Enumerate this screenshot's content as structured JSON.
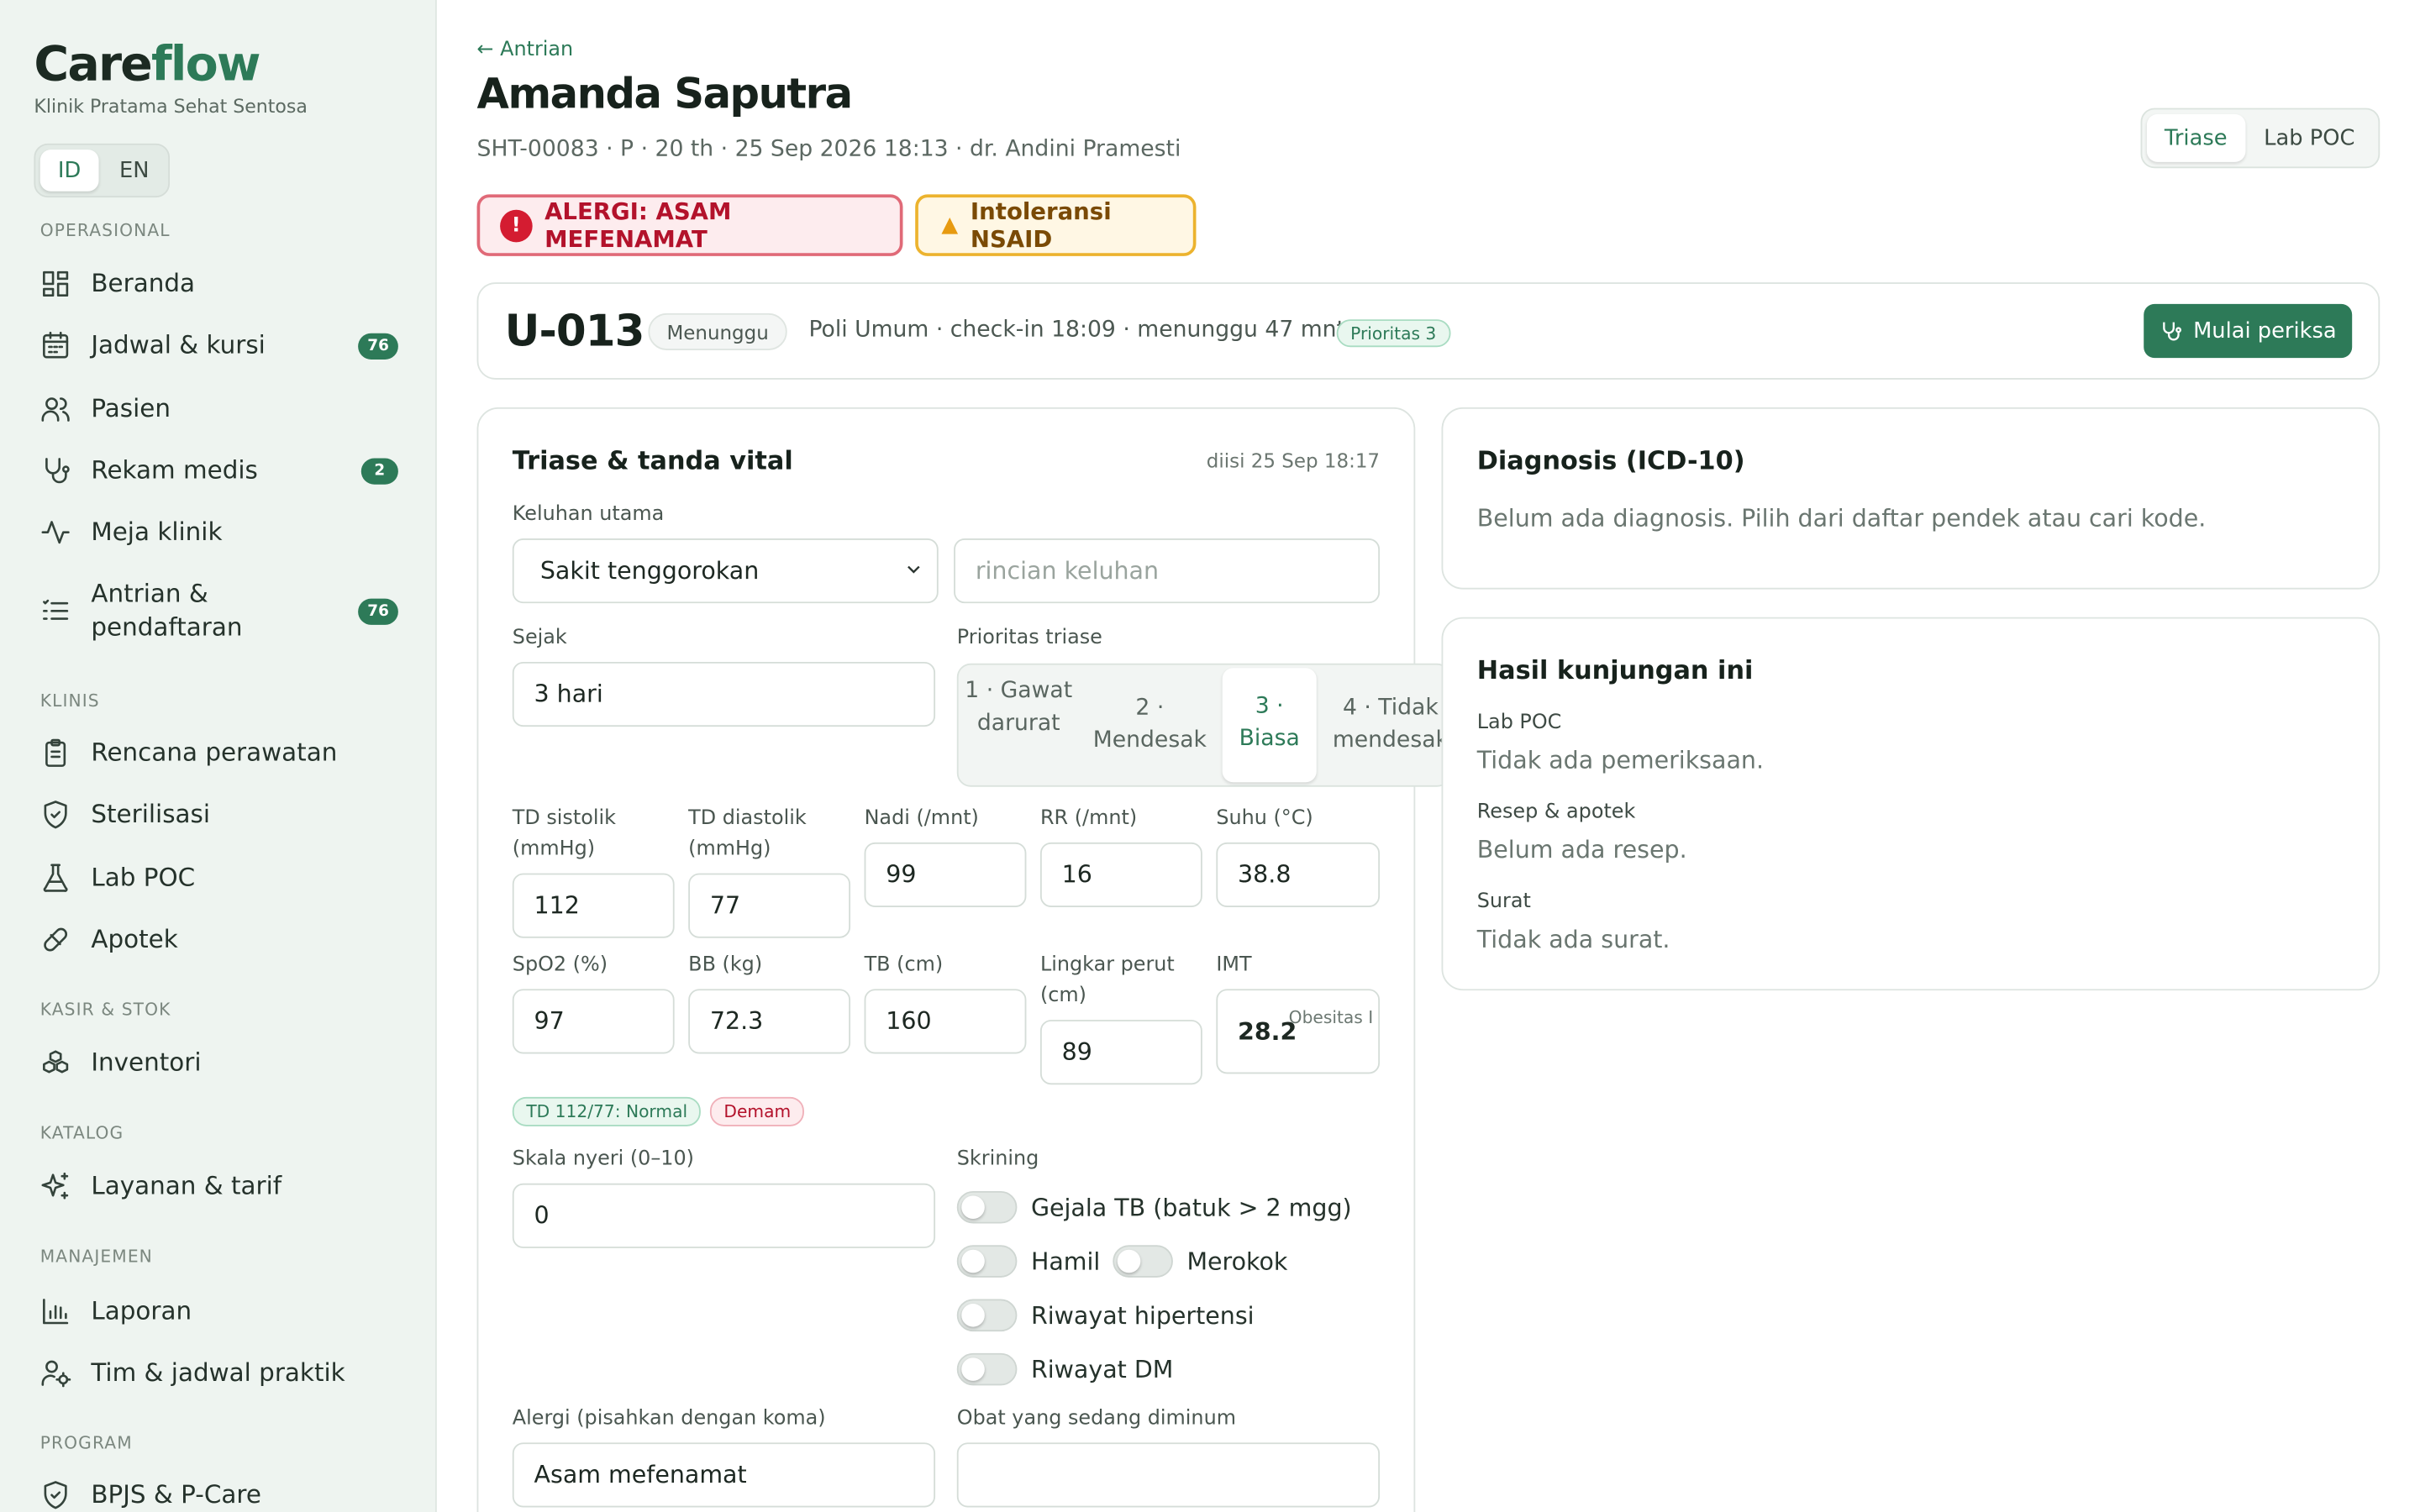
{
  "brand": {
    "part1": "Care",
    "part2": "flow",
    "clinic": "Klinik Pratama Sehat Sentosa"
  },
  "lang": {
    "id": "ID",
    "en": "EN",
    "active": "ID"
  },
  "sidebar": {
    "sections": [
      "OPERASIONAL",
      "KLINIS",
      "KASIR & STOK",
      "KATALOG",
      "MANAJEMEN",
      "PROGRAM"
    ],
    "items": [
      {
        "label": "Beranda",
        "icon": "dashboard-icon"
      },
      {
        "label": "Jadwal & kursi",
        "icon": "calendar-icon",
        "badge": "76"
      },
      {
        "label": "Pasien",
        "icon": "users-icon"
      },
      {
        "label": "Rekam medis",
        "icon": "stethoscope-icon",
        "badge": "2"
      },
      {
        "label": "Meja klinik",
        "icon": "activity-icon"
      },
      {
        "label": "Antrian & pendaftaran",
        "icon": "list-icon",
        "badge": "76"
      },
      {
        "label": "Rencana perawatan",
        "icon": "clipboard-icon"
      },
      {
        "label": "Sterilisasi",
        "icon": "shield-icon"
      },
      {
        "label": "Lab POC",
        "icon": "flask-icon"
      },
      {
        "label": "Apotek",
        "icon": "pill-icon"
      },
      {
        "label": "Inventori",
        "icon": "boxes-icon"
      },
      {
        "label": "Layanan & tarif",
        "icon": "sparkles-icon"
      },
      {
        "label": "Laporan",
        "icon": "bar-chart-icon"
      },
      {
        "label": "Tim & jadwal praktik",
        "icon": "user-cog-icon"
      },
      {
        "label": "BPJS & P-Care",
        "icon": "shield-check-icon"
      }
    ]
  },
  "header": {
    "back": "← Antrian",
    "patient_name": "Amanda Saputra",
    "meta": "SHT-00083 · P · 20 th · 25 Sep 2026 18:13 · dr. Andini Pramesti",
    "tabs": [
      "Triase",
      "Lab POC"
    ],
    "active_tab": "Triase"
  },
  "alerts": {
    "allergy": "ALERGI: ASAM MEFENAMAT",
    "intolerance": "Intoleransi NSAID"
  },
  "queue": {
    "number": "U-013",
    "status": "Menunggu",
    "info": "Poli Umum · check-in 18:09 · menunggu 47 mnt ·",
    "priority": "Prioritas 3",
    "start_button": "Mulai periksa"
  },
  "triage": {
    "title": "Triase & tanda vital",
    "filled": "diisi 25 Sep 18:17",
    "complaint_label": "Keluhan utama",
    "complaint_value": "Sakit tenggorokan",
    "complaint_detail_placeholder": "rincian keluhan",
    "since_label": "Sejak",
    "since_value": "3 hari",
    "priority_label": "Prioritas triase",
    "priority_options": [
      "1 · Gawat darurat",
      "2 · Mendesak",
      "3 · Biasa",
      "4 · Tidak mendesak"
    ],
    "priority_selected": "3 · Biasa",
    "vitals": {
      "sys_label": "TD sistolik (mmHg)",
      "sys": "112",
      "dia_label": "TD diastolik (mmHg)",
      "dia": "77",
      "pulse_label": "Nadi (/mnt)",
      "pulse": "99",
      "rr_label": "RR (/mnt)",
      "rr": "16",
      "temp_label": "Suhu (°C)",
      "temp": "38.8",
      "spo2_label": "SpO2 (%)",
      "spo2": "97",
      "bb_label": "BB (kg)",
      "bb": "72.3",
      "tb_label": "TB (cm)",
      "tb": "160",
      "waist_label": "Lingkar perut (cm)",
      "waist": "89",
      "imt_label": "IMT",
      "imt": "28.2",
      "imt_class": "Obesitas I"
    },
    "tags": {
      "bp": "TD 112/77: Normal",
      "fever": "Demam"
    },
    "pain_label": "Skala nyeri (0–10)",
    "pain_value": "0",
    "screening_label": "Skrining",
    "screening": [
      "Gejala TB (batuk > 2 mgg)",
      "Hamil",
      "Merokok",
      "Riwayat hipertensi",
      "Riwayat DM"
    ],
    "allergy_label": "Alergi (pisahkan dengan koma)",
    "allergy_value": "Asam mefenamat",
    "meds_label": "Obat yang sedang diminum",
    "meds_value": ""
  },
  "diagnosis": {
    "title": "Diagnosis (ICD-10)",
    "empty": "Belum ada diagnosis. Pilih dari daftar pendek atau cari kode."
  },
  "visit": {
    "title": "Hasil kunjungan ini",
    "lab_label": "Lab POC",
    "lab_value": "Tidak ada pemeriksaan.",
    "rx_label": "Resep & apotek",
    "rx_value": "Belum ada resep.",
    "letter_label": "Surat",
    "letter_value": "Tidak ada surat."
  },
  "colors": {
    "accent": "#2d7a58",
    "danger": "#d41c31",
    "warning": "#ecb32e",
    "sidebar": "#eef4f0"
  }
}
